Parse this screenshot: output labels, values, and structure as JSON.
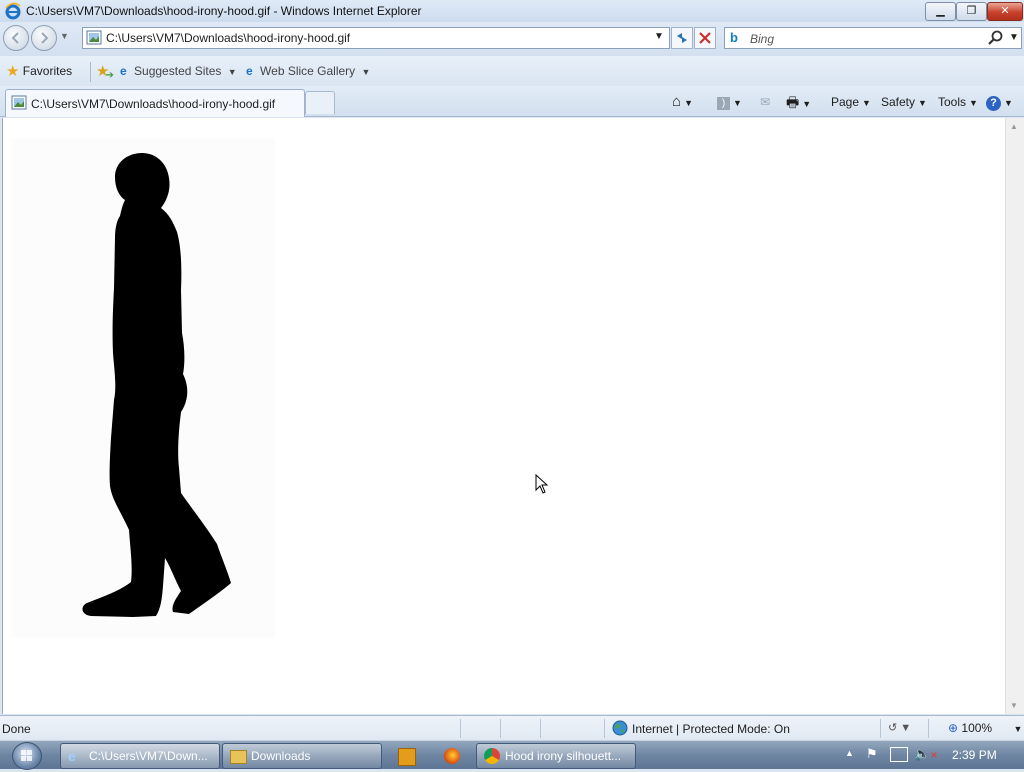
{
  "window": {
    "title": "C:\\Users\\VM7\\Downloads\\hood-irony-hood.gif - Windows Internet Explorer"
  },
  "address_bar": {
    "url": "C:\\Users\\VM7\\Downloads\\hood-irony-hood.gif"
  },
  "search": {
    "placeholder": "Bing"
  },
  "favorites_bar": {
    "favorites_label": "Favorites",
    "items": [
      "Suggested Sites",
      "Web Slice Gallery"
    ]
  },
  "tabs": [
    {
      "label": "C:\\Users\\VM7\\Downloads\\hood-irony-hood.gif"
    }
  ],
  "command_bar": {
    "page_label": "Page",
    "safety_label": "Safety",
    "tools_label": "Tools"
  },
  "status_bar": {
    "status": "Done",
    "zone": "Internet | Protected Mode: On",
    "zoom": "100%"
  },
  "taskbar": {
    "items": [
      {
        "label": "C:\\Users\\VM7\\Down...",
        "icon": "ie-icon"
      },
      {
        "label": "Downloads",
        "icon": "folder-icon"
      },
      {
        "label": "",
        "icon": "media-player-icon"
      },
      {
        "label": "",
        "icon": "firefox-icon"
      },
      {
        "label": "Hood irony silhouett...",
        "icon": "chrome-icon"
      }
    ],
    "clock": "2:39 PM"
  },
  "colors": {
    "titlebar": "#d6e3f2",
    "close_button": "#c8412c",
    "taskbar": "#6f86a3",
    "silhouette": "#000000"
  }
}
